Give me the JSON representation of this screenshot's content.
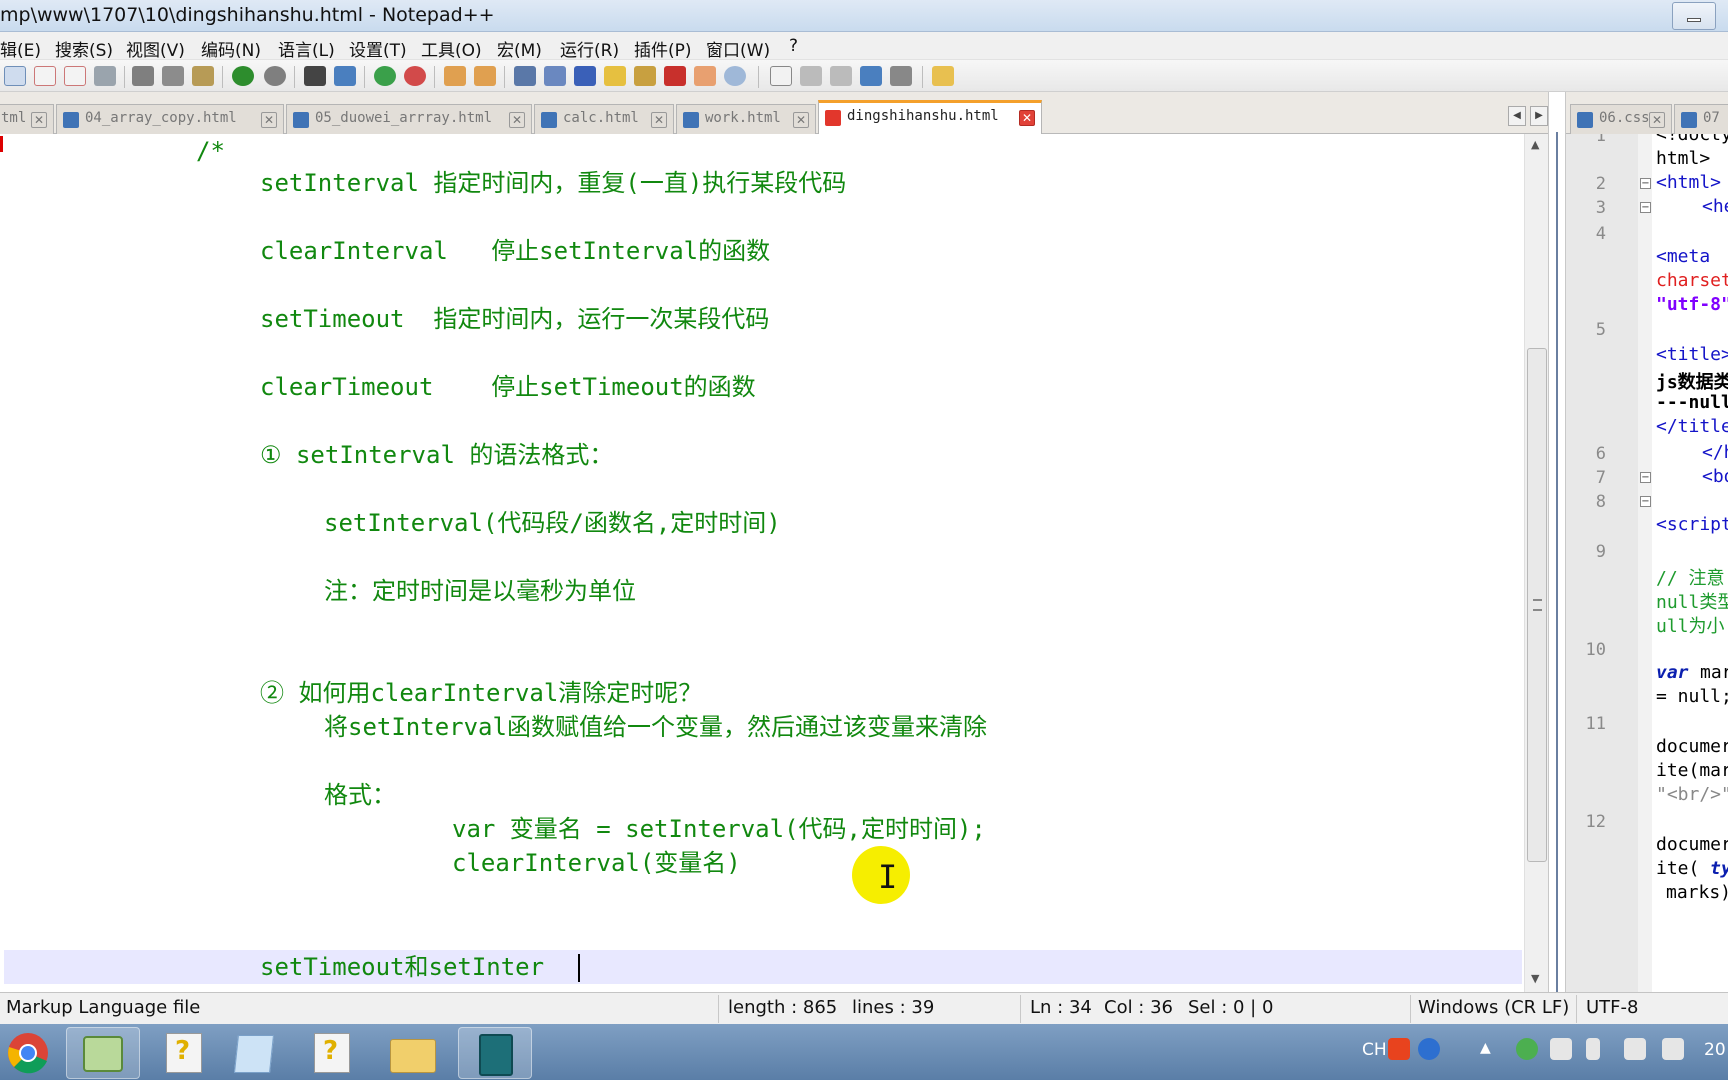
{
  "window": {
    "title": "mp\\www\\1707\\10\\dingshihanshu.html - Notepad++"
  },
  "menu": [
    "辑(E)",
    "搜索(S)",
    "视图(V)",
    "编码(N)",
    "语言(L)",
    "设置(T)",
    "工具(O)",
    "宏(M)",
    "运行(R)",
    "插件(P)",
    "窗口(W)",
    "?"
  ],
  "tabs": [
    {
      "label": "tml",
      "active": false
    },
    {
      "label": "04_array_copy.html",
      "active": false
    },
    {
      "label": "05_duowei_arrray.html",
      "active": false
    },
    {
      "label": "calc.html",
      "active": false
    },
    {
      "label": "work.html",
      "active": false
    },
    {
      "label": "dingshihanshu.html",
      "active": true
    }
  ],
  "right_tabs": [
    {
      "label": "06.css"
    },
    {
      "label": "07"
    }
  ],
  "editor": {
    "lines": [
      "/*",
      "setInterval 指定时间内，重复(一直)执行某段代码",
      "clearInterval   停止setInterval的函数",
      "setTimeout  指定时间内，运行一次某段代码",
      "clearTimeout    停止setTimeout的函数",
      "① setInterval 的语法格式：",
      "setInterval(代码段/函数名,定时时间)",
      "注：定时时间是以毫秒为单位",
      "② 如何用clearInterval清除定时呢？",
      "将setInterval函数赋值给一个变量，然后通过该变量来清除",
      "格式：",
      "var 变量名 = setInterval(代码,定时时间);",
      "clearInterval(变量名)",
      "setTimeout和setInter"
    ]
  },
  "right_pane": {
    "line_numbers": [
      "1",
      "2",
      "3",
      "4",
      "5",
      "6",
      "7",
      "8",
      "9",
      "10",
      "11",
      "12"
    ],
    "lines": [
      "<!docty",
      "html>",
      "<html>",
      "<he",
      "<meta",
      "charset",
      "\"utf-8\"",
      "<title>",
      "js数据类",
      "---null",
      "</title",
      "</h",
      "<bo",
      "<script",
      "// 注意",
      "null类型",
      "ull为小",
      "var",
      "mar",
      "= null;",
      "documer",
      "ite(mar",
      "\"<br/>\"",
      "documer",
      "ite(",
      "typ",
      "marks)"
    ]
  },
  "status": {
    "file_type": "Markup Language file",
    "length": "length : 865",
    "lines": "lines : 39",
    "ln": "Ln : 34",
    "col": "Col : 36",
    "sel": "Sel : 0 | 0",
    "eol": "Windows (CR LF)",
    "encoding": "UTF-8"
  },
  "taskbar": {
    "lang": "CH",
    "clock": "20"
  },
  "colors": {
    "code_green": "#11880f",
    "tab_active_accent": "#f4a02b",
    "tag_blue": "#1414c8",
    "attr_red": "#e02020",
    "current_line": "#e8e8ff",
    "cursor_highlight": "#f6ee00"
  }
}
